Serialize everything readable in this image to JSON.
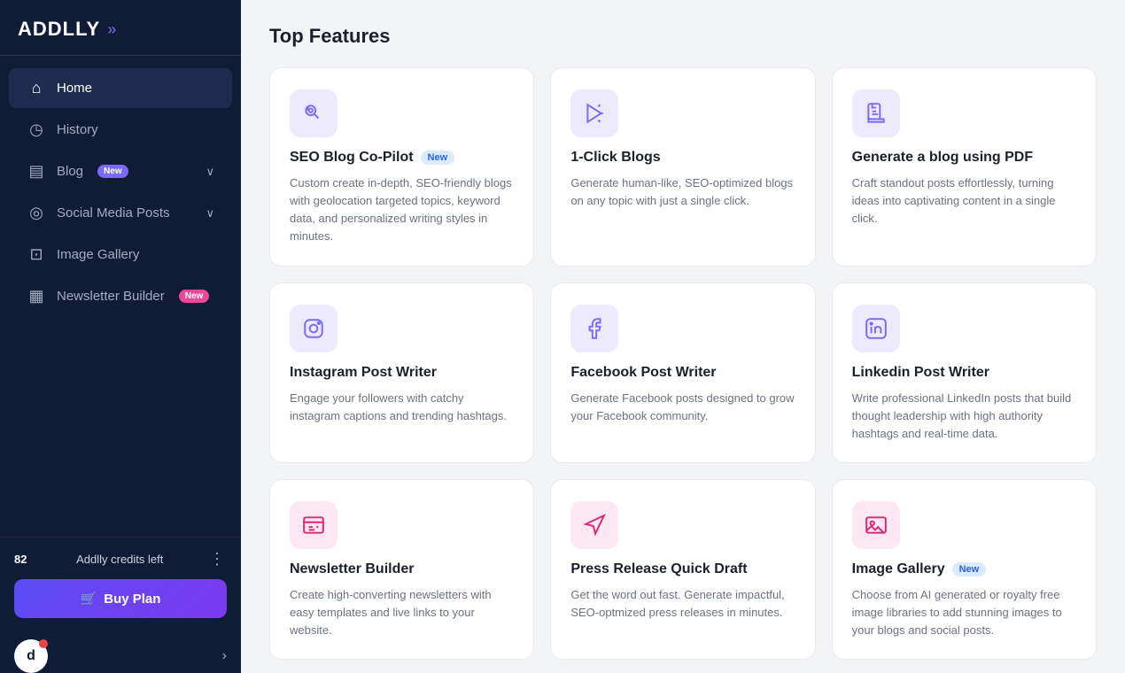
{
  "logo": {
    "text": "ADDLLY",
    "arrow": "»"
  },
  "nav": {
    "items": [
      {
        "id": "home",
        "label": "Home",
        "icon": "⌂",
        "active": true
      },
      {
        "id": "history",
        "label": "History",
        "icon": "◷",
        "active": false
      },
      {
        "id": "blog",
        "label": "Blog",
        "icon": "▤",
        "badge": "New",
        "chevron": "∨",
        "active": false
      },
      {
        "id": "social",
        "label": "Social Media Posts",
        "icon": "◎",
        "chevron": "∨",
        "active": false
      },
      {
        "id": "image",
        "label": "Image Gallery",
        "icon": "⊡",
        "active": false
      },
      {
        "id": "newsletter",
        "label": "Newsletter Builder",
        "icon": "▦",
        "badge": "New",
        "active": false
      }
    ]
  },
  "credits": {
    "count": "82",
    "label": "Addlly credits left"
  },
  "buy_btn": {
    "label": "Buy Plan",
    "icon": "🛒"
  },
  "user": {
    "avatar_letter": "d",
    "chevron": "›"
  },
  "page_title": "Top Features",
  "features": [
    {
      "id": "seo-blog",
      "icon": "💬",
      "icon_style": "purple",
      "title": "SEO Blog Co-Pilot",
      "badge": "New",
      "desc": "Custom create in-depth, SEO-friendly blogs with geolocation targeted topics, keyword data, and personalized writing styles in minutes."
    },
    {
      "id": "one-click-blogs",
      "icon": "↗",
      "icon_style": "purple",
      "title": "1-Click Blogs",
      "badge": null,
      "desc": "Generate human-like, SEO-optimized blogs on any topic with just a single click."
    },
    {
      "id": "pdf-blog",
      "icon": "📄",
      "icon_style": "purple",
      "title": "Generate a blog using PDF",
      "badge": null,
      "desc": "Craft standout posts effortlessly, turning ideas into captivating content in a single click."
    },
    {
      "id": "instagram",
      "icon": "📷",
      "icon_style": "purple",
      "title": "Instagram Post Writer",
      "badge": null,
      "desc": "Engage your followers with catchy instagram captions and trending hashtags."
    },
    {
      "id": "facebook",
      "icon": "f",
      "icon_style": "purple",
      "title": "Facebook Post Writer",
      "badge": null,
      "desc": "Generate Facebook posts designed to grow your Facebook community."
    },
    {
      "id": "linkedin",
      "icon": "in",
      "icon_style": "purple",
      "title": "Linkedin Post Writer",
      "badge": null,
      "desc": "Write professional LinkedIn posts that build thought leadership with high authority hashtags and real-time data."
    },
    {
      "id": "newsletter-builder",
      "icon": "📰",
      "icon_style": "pink",
      "title": "Newsletter Builder",
      "badge": null,
      "desc": "Create high-converting newsletters with easy templates and live links to your website."
    },
    {
      "id": "press-release",
      "icon": "📢",
      "icon_style": "pink",
      "title": "Press Release Quick Draft",
      "badge": null,
      "desc": "Get the word out fast. Generate impactful, SEO-optmized press releases in minutes."
    },
    {
      "id": "image-gallery",
      "icon": "🖼",
      "icon_style": "pink",
      "title": "Image Gallery",
      "badge": "New",
      "desc": "Choose from AI generated or royalty free image libraries to add stunning images to your blogs and social posts."
    }
  ]
}
